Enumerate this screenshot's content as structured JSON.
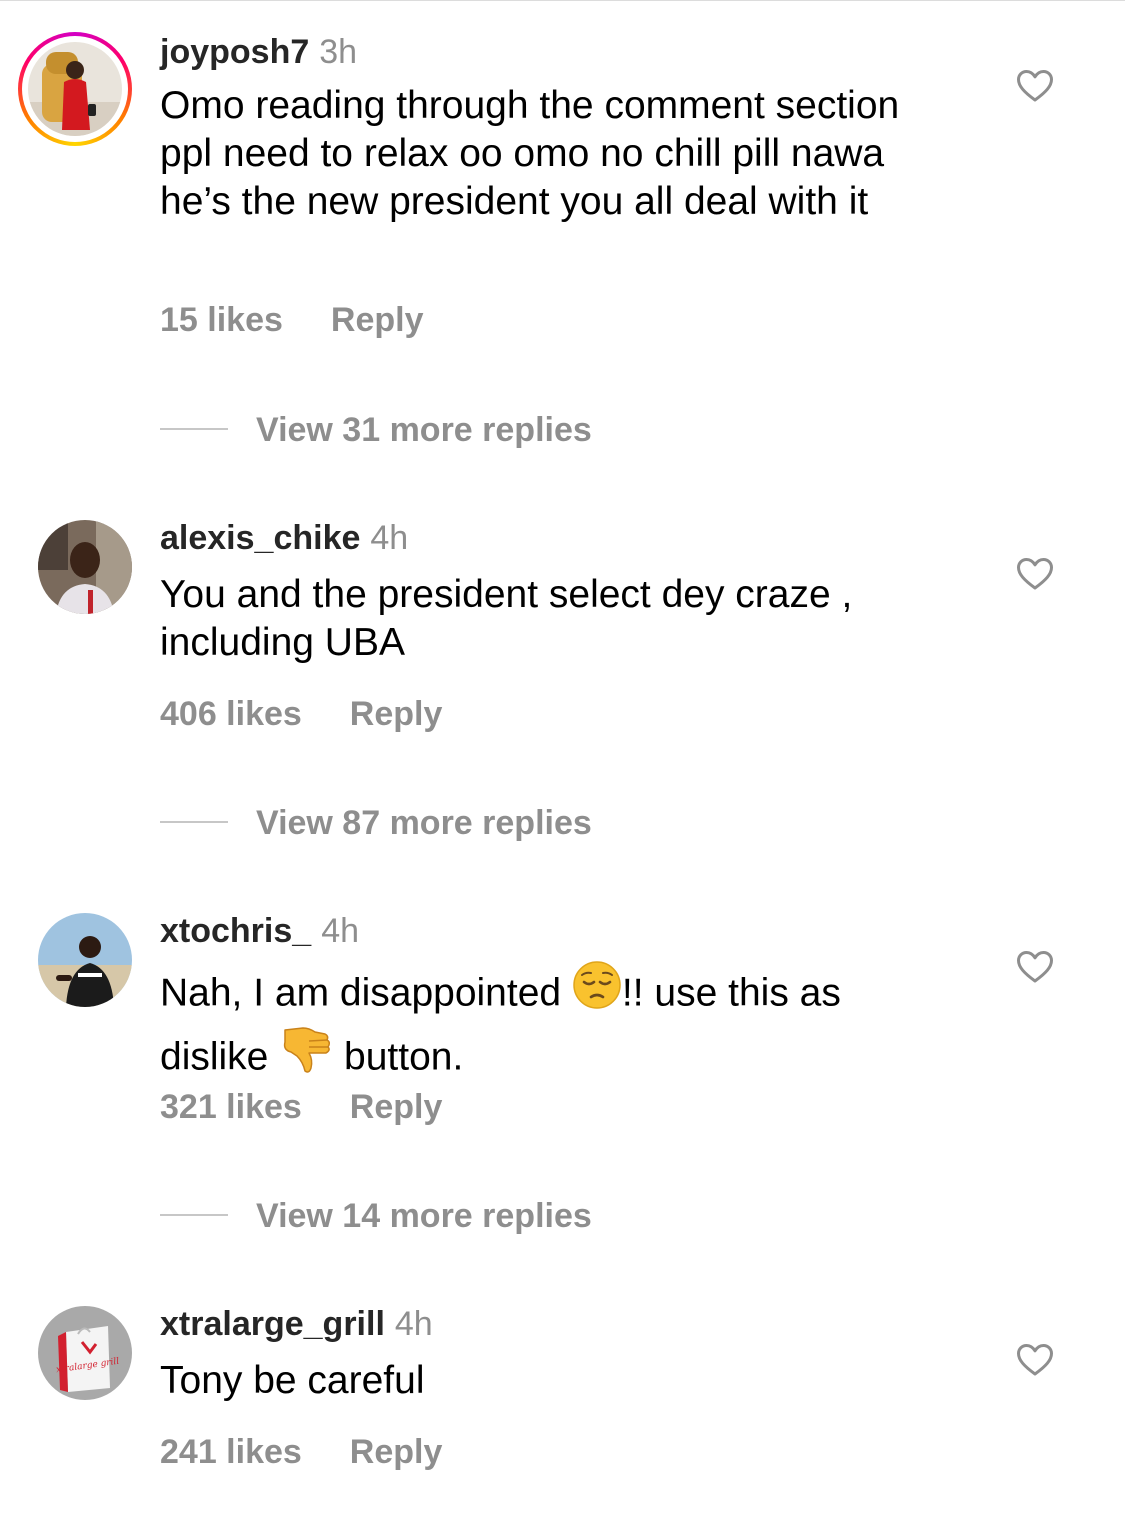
{
  "comments": [
    {
      "username": "joyposh7",
      "time": "3h",
      "text": "Omo reading through the comment section ppl need to relax oo omo no chill pill nawa he’s the new president you all deal with it",
      "likes": "15 likes",
      "reply_label": "Reply",
      "view_replies": "View 31 more replies",
      "has_story_ring": true
    },
    {
      "username": "alexis_chike",
      "time": "4h",
      "text": "You and the president select dey craze , including UBA",
      "likes": "406 likes",
      "reply_label": "Reply",
      "view_replies": "View 87 more replies"
    },
    {
      "username": "xtochris_",
      "time": "4h",
      "text_part1": "Nah, I am disappointed ",
      "emoji1": "pensive-face-emoji",
      "text_part2": "!! use this as dislike ",
      "emoji2": "thumbs-down-emoji",
      "text_part3": " button.",
      "likes": "321 likes",
      "reply_label": "Reply",
      "view_replies": "View 14 more replies"
    },
    {
      "username": "xtralarge_grill",
      "time": "4h",
      "text": "Tony be careful",
      "likes": "241 likes",
      "reply_label": "Reply",
      "avatar_label": "xtralarge grill"
    }
  ],
  "icons": {
    "like": "heart-outline-icon"
  },
  "colors": {
    "secondary_text": "#8e8e8e",
    "primary_text": "#000000",
    "story_ring": [
      "#d300c5",
      "#ff0069",
      "#ff7a00",
      "#ffd600"
    ]
  }
}
